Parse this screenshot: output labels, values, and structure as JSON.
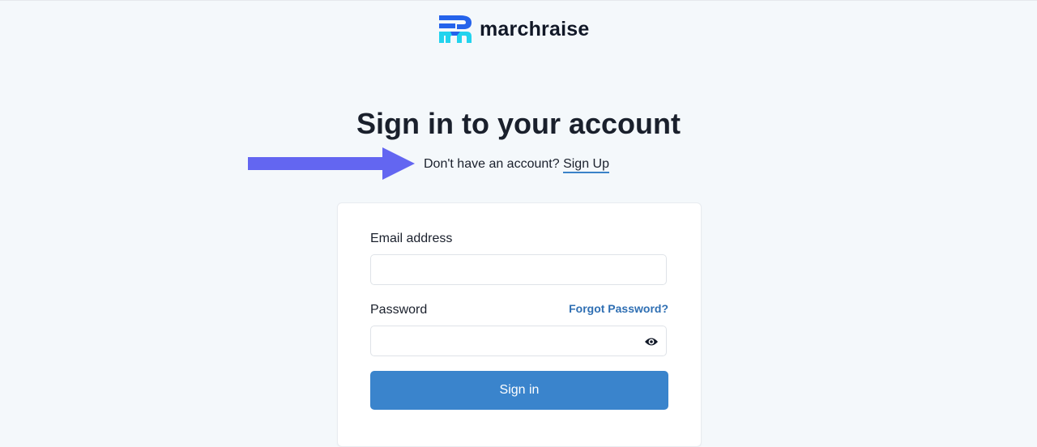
{
  "brand": {
    "name": "marchraise",
    "logo_icon": "marchraise-logo-icon"
  },
  "page": {
    "title": "Sign in to your account"
  },
  "signup": {
    "prompt": "Don't have an account?",
    "link_label": "Sign Up"
  },
  "annotation": {
    "icon": "arrow-right-icon",
    "color": "#6366f1"
  },
  "form": {
    "email_label": "Email address",
    "email_value": "",
    "password_label": "Password",
    "password_value": "",
    "forgot_label": "Forgot Password?",
    "show_password_icon": "eye-icon",
    "submit_label": "Sign in"
  },
  "colors": {
    "background": "#f4f8fb",
    "primary_button": "#3a84cc",
    "link": "#2f6fb3",
    "arrow": "#6366f1",
    "logo_blue": "#2563eb",
    "logo_cyan": "#22d3ee"
  }
}
